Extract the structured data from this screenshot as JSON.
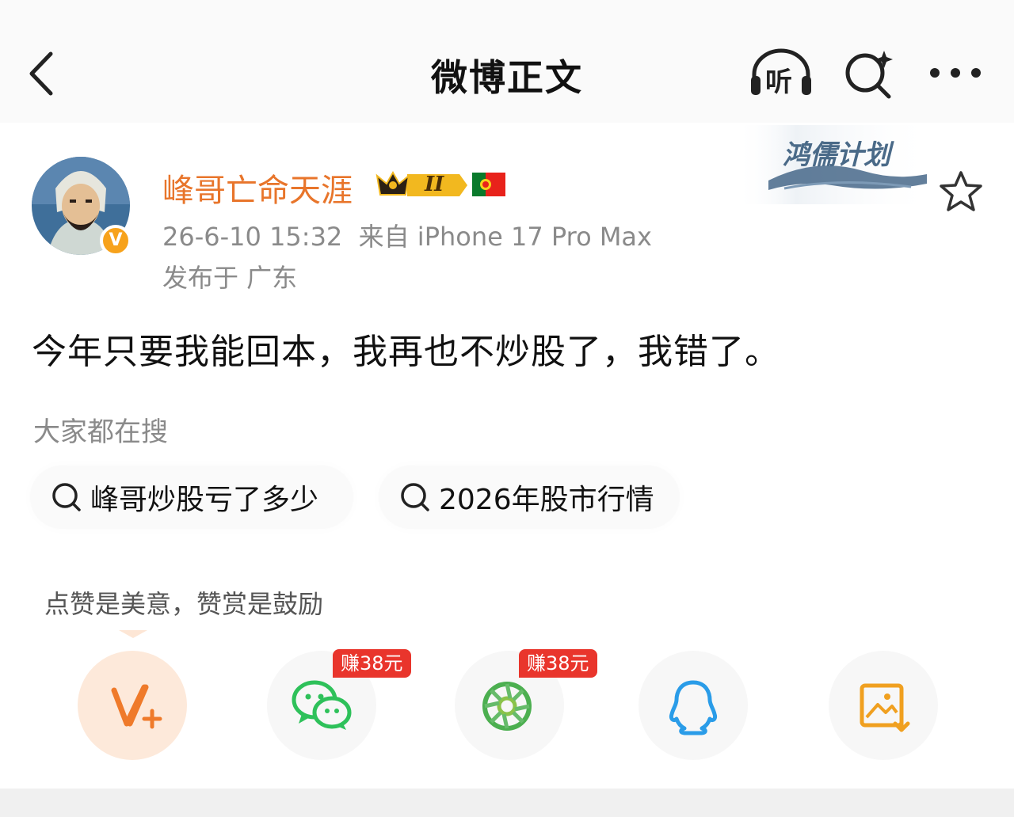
{
  "header": {
    "title": "微博正文",
    "listen_label": "听"
  },
  "post": {
    "username": "峰哥亡命天涯",
    "badge_level": "II",
    "verified_mark": "V",
    "meta": "26-6-10 15:32  来自 iPhone 17 Pro Max",
    "location": "发布于 广东",
    "plan_banner": "鸿儒计划",
    "text": "今年只要我能回本，我再也不炒股了，我错了。"
  },
  "searches": {
    "heading": "大家都在搜",
    "items": [
      {
        "label": "峰哥炒股亏了多少"
      },
      {
        "label": "2026年股市行情"
      }
    ]
  },
  "reward": {
    "text": "点赞是美意，赞赏是鼓励"
  },
  "share": {
    "items": [
      {
        "icon": "reward-v-plus-icon"
      },
      {
        "icon": "wechat-icon",
        "tag": "赚38元"
      },
      {
        "icon": "moments-icon",
        "tag": "赚38元"
      },
      {
        "icon": "qq-icon"
      },
      {
        "icon": "save-image-icon"
      }
    ]
  },
  "colors": {
    "username": "#e8752b",
    "meta": "#8a8a8a",
    "earn_tag": "#e9352c",
    "wechat": "#2ec15a",
    "moments": "#4caf50",
    "qq": "#2a9ce8",
    "save": "#f0a020"
  }
}
